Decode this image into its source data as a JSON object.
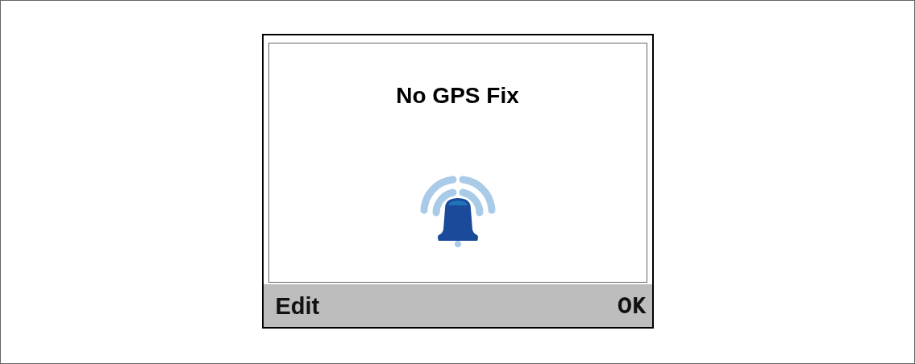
{
  "screen": {
    "title": "No GPS Fix"
  },
  "softkeys": {
    "left": "Edit",
    "right": "OK"
  }
}
